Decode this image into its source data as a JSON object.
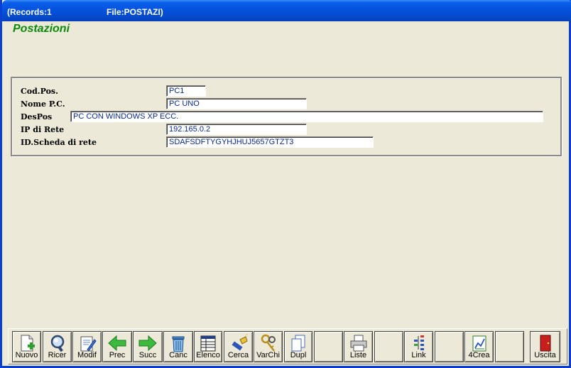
{
  "window": {
    "records": "(Records:1",
    "file": "File:POSTAZI)"
  },
  "form": {
    "title": "Postazioni"
  },
  "fields": [
    {
      "label": "Cod.Pos.",
      "value": "PC1"
    },
    {
      "label": "Nome P.C.",
      "value": "PC UNO"
    },
    {
      "label": "DesPos",
      "value": "PC CON WINDOWS XP  ECC."
    },
    {
      "label": "IP di Rete",
      "value": "192.165.0.2"
    },
    {
      "label": "ID.Scheda di rete",
      "value": "SDAFSDFTYGYHJHUJ5657GTZT3"
    }
  ],
  "toolbar": {
    "buttons": [
      {
        "label": "Nuovo",
        "icon": "new-document-icon"
      },
      {
        "label": "Ricer",
        "icon": "magnifier-icon"
      },
      {
        "label": "Modif",
        "icon": "edit-document-icon"
      },
      {
        "label": "Prec",
        "icon": "arrow-left-icon"
      },
      {
        "label": "Succ",
        "icon": "arrow-right-icon"
      },
      {
        "label": "Canc",
        "icon": "trash-icon"
      },
      {
        "label": "Elenco",
        "icon": "list-grid-icon"
      },
      {
        "label": "Cerca",
        "icon": "flashlight-icon"
      },
      {
        "label": "VarChi",
        "icon": "keys-icon"
      },
      {
        "label": "Dupl",
        "icon": "duplicate-icon"
      },
      {
        "label": "",
        "icon": ""
      },
      {
        "label": "Liste",
        "icon": "printer-icon"
      },
      {
        "label": "",
        "icon": ""
      },
      {
        "label": "Link",
        "icon": "link-tree-icon"
      },
      {
        "label": "",
        "icon": ""
      },
      {
        "label": "4Crea",
        "icon": "create-chart-icon"
      },
      {
        "label": "",
        "icon": ""
      },
      {
        "label": "Uscita",
        "icon": "exit-door-icon"
      }
    ]
  },
  "colors": {
    "title_green": "#0C8A0C",
    "field_text": "#0A2A8A",
    "titlebar_blue": "#0551DC"
  }
}
